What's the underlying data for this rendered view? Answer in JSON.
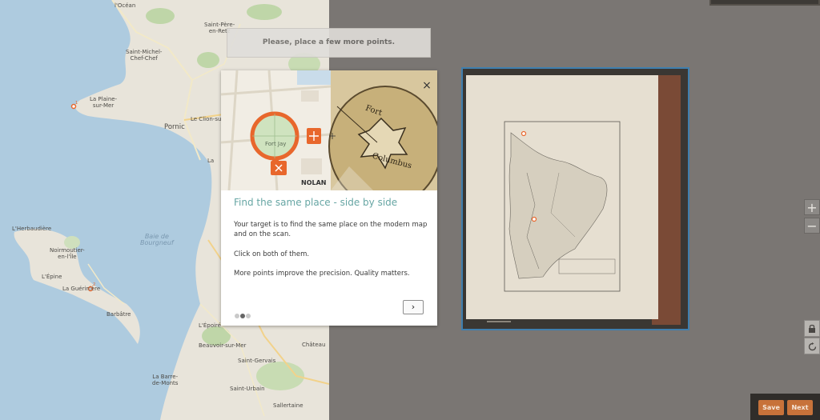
{
  "hint": {
    "text": "Please, place a few more points."
  },
  "modal": {
    "title": "Find the same place - side by side",
    "paragraphs": [
      "Your target is to find the same place on the modern map and on the scan.",
      "Click on both of them.",
      "More points improve the precision. Quality matters."
    ],
    "illustration": {
      "map_place_label": "Fort Jay",
      "street_label": "NOLAN",
      "scan_label_1": "Fort",
      "scan_label_2": "Columbus"
    },
    "pager": {
      "total": 3,
      "active": 1
    },
    "next_symbol": "›",
    "close_symbol": "×"
  },
  "map": {
    "labels": {
      "ocean": "l'Océan",
      "saint_pere": "Saint-Père-\nen-Retz",
      "saint_michel": "Saint-Michel-\nChef-Chef",
      "la_plaine": "La Plaine-\nsur-Mer",
      "pornic": "Pornic",
      "le_clion": "Le Clion-su",
      "la": "La",
      "lherbaudiere": "L'Herbaudière",
      "noirmoutier": "Noirmoutier-\nen-l'Île",
      "lepine": "L'Épine",
      "la_gueriniere": "La Guérinière",
      "baie": "Baie de\nBourgneuf",
      "barbatre": "Barbâtre",
      "lepoiré": "L'Époiré",
      "beauvoir": "Beauvoir-sur-Mer",
      "chateau": "Château",
      "saint_gervais": "Saint-Gervais",
      "la_barre": "La Barre-\nde-Monts",
      "saint_urbain": "Saint-Urbain",
      "sallertaine": "Sallertaine"
    },
    "points": [
      "1",
      "2"
    ]
  },
  "controls": {
    "zoom_in": "+",
    "zoom_out": "−",
    "lock_icon": "lock",
    "reset_icon": "rotate"
  },
  "footer": {
    "save_label": "Save",
    "next_label": "Next"
  },
  "colors": {
    "accent": "#c7723a",
    "frame": "#3f7fae",
    "title": "#67a6a4",
    "marker": "#e8672c"
  }
}
